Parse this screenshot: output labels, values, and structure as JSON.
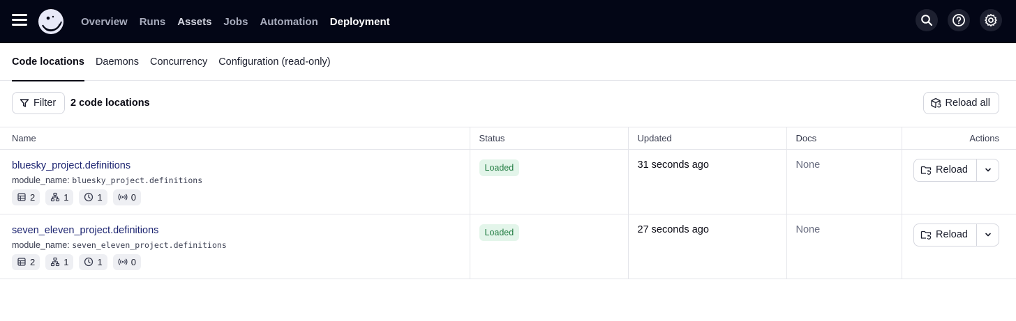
{
  "nav": {
    "items": [
      {
        "label": "Overview",
        "active": false
      },
      {
        "label": "Runs",
        "active": false
      },
      {
        "label": "Assets",
        "active": false
      },
      {
        "label": "Jobs",
        "active": false
      },
      {
        "label": "Automation",
        "active": false
      },
      {
        "label": "Deployment",
        "active": true
      }
    ],
    "right_icons": [
      "search-icon",
      "help-icon",
      "gear-icon"
    ]
  },
  "tabs": [
    {
      "label": "Code locations",
      "active": true
    },
    {
      "label": "Daemons",
      "active": false
    },
    {
      "label": "Concurrency",
      "active": false
    },
    {
      "label": "Configuration (read-only)",
      "active": false
    }
  ],
  "toolbar": {
    "filter_label": "Filter",
    "count_label": "2 code locations",
    "reload_all_label": "Reload all"
  },
  "table": {
    "headers": {
      "name": "Name",
      "status": "Status",
      "updated": "Updated",
      "docs": "Docs",
      "actions": "Actions"
    },
    "rows": [
      {
        "name": "bluesky_project.definitions",
        "module_label": "module_name:",
        "module_value": "bluesky_project.definitions",
        "chips": {
          "assets": "2",
          "jobs": "1",
          "schedules": "1",
          "sensors": "0"
        },
        "status": "Loaded",
        "updated": "31 seconds ago",
        "docs": "None",
        "reload_label": "Reload"
      },
      {
        "name": "seven_eleven_project.definitions",
        "module_label": "module_name:",
        "module_value": "seven_eleven_project.definitions",
        "chips": {
          "assets": "2",
          "jobs": "1",
          "schedules": "1",
          "sensors": "0"
        },
        "status": "Loaded",
        "updated": "27 seconds ago",
        "docs": "None",
        "reload_label": "Reload"
      }
    ]
  },
  "colors": {
    "topbar_bg": "#030616",
    "link": "#1b2370",
    "loaded_bg": "#e3f5ea",
    "loaded_text": "#1e7a3f"
  }
}
